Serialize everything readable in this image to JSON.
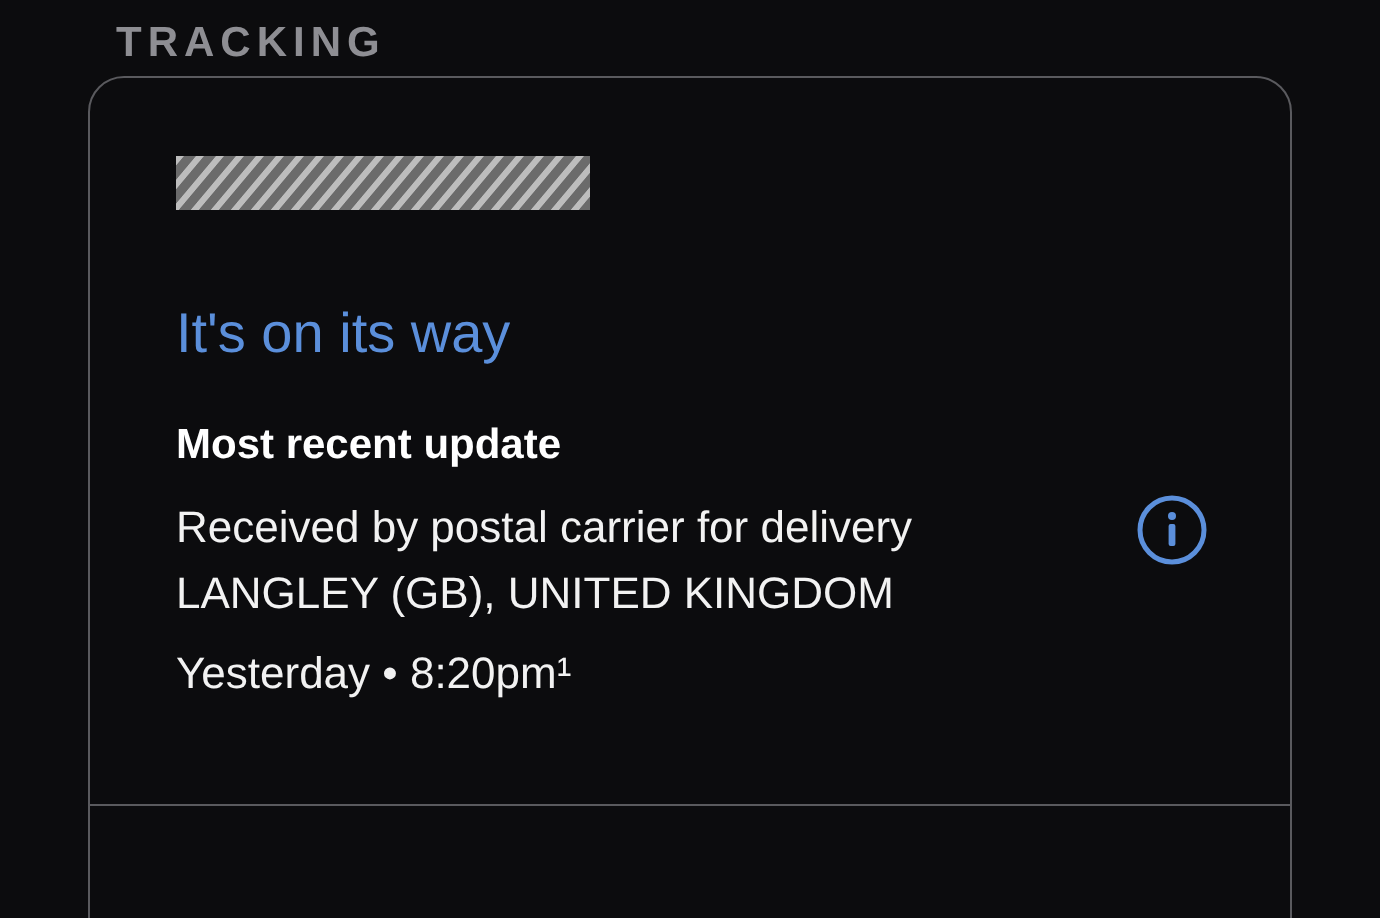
{
  "section_title": "TRACKING",
  "tracking_card": {
    "status": "It's on its way",
    "update_heading": "Most recent update",
    "update_lines": [
      "Received by postal carrier for delivery",
      "LANGLEY (GB), UNITED KINGDOM"
    ],
    "timestamp": "Yesterday • 8:20pm¹"
  }
}
